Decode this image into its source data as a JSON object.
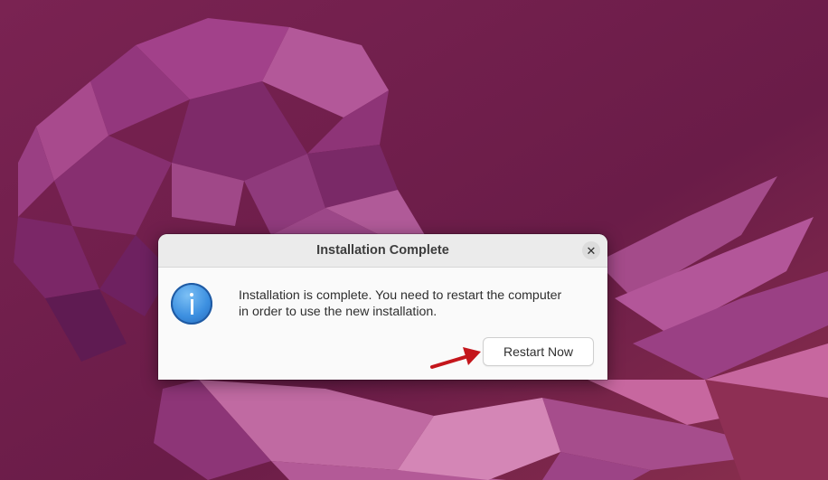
{
  "dialog": {
    "title": "Installation Complete",
    "message_line1": "Installation is complete. You need to restart the computer",
    "message_line2": "in order to use the new installation.",
    "restart_label": "Restart Now",
    "close_glyph": "✕"
  },
  "icons": {
    "info": "info-icon",
    "close": "close-icon",
    "annotation": "red-arrow-icon"
  },
  "colors": {
    "wallpaper_base": "#6e1d4c",
    "wallpaper_accent": "#b04e93",
    "dialog_bg": "#fafafa",
    "titlebar_bg": "#ebebeb",
    "info_blue": "#3c8fe0",
    "arrow_red": "#c4161c"
  }
}
